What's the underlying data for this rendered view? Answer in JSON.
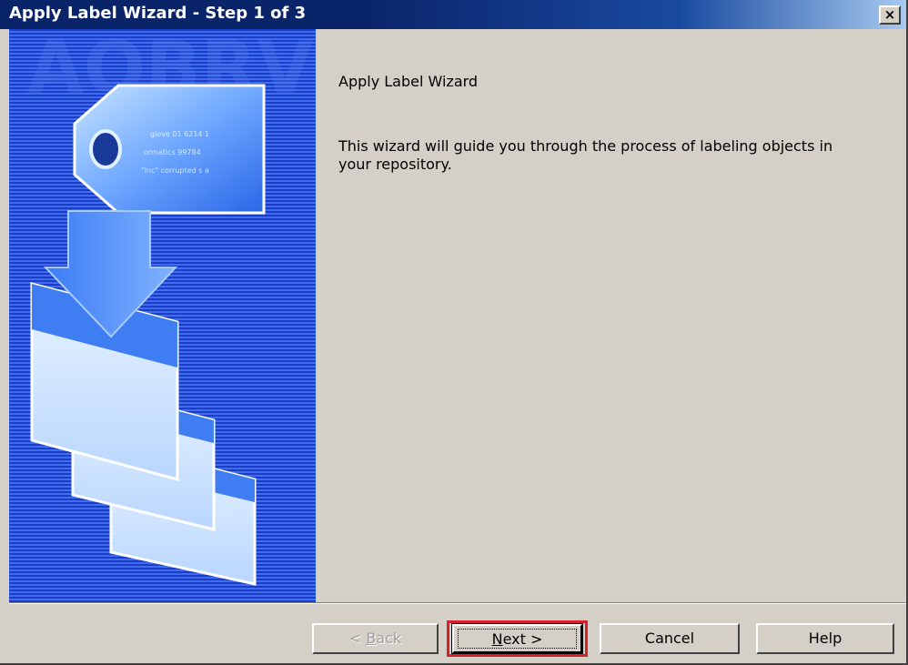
{
  "window": {
    "title": "Apply Label Wizard - Step 1 of 3",
    "close_glyph": "×",
    "close_icon": "close-icon"
  },
  "side_image": {
    "tag_text_lines": [
      "glove 01 6214 1",
      "ormatics 99784",
      "\"Inc\" corrupted s a"
    ],
    "icons": [
      "tag-icon",
      "down-arrow-icon",
      "document-stack-icon"
    ]
  },
  "content": {
    "heading": "Apply Label Wizard",
    "description": "This wizard will guide you through the process of labeling objects in your repository."
  },
  "buttons": {
    "back": {
      "prefix": "< ",
      "mnemonic": "B",
      "rest": "ack",
      "disabled": true
    },
    "next": {
      "mnemonic": "N",
      "rest": "ext >",
      "focused": true
    },
    "cancel": "Cancel",
    "help": "Help"
  },
  "colors": {
    "title_bar": "#0a246a",
    "dialog_bg": "#d4d0c8",
    "highlight_box": "#d8202a",
    "image_blue": "#1b3ec4"
  }
}
